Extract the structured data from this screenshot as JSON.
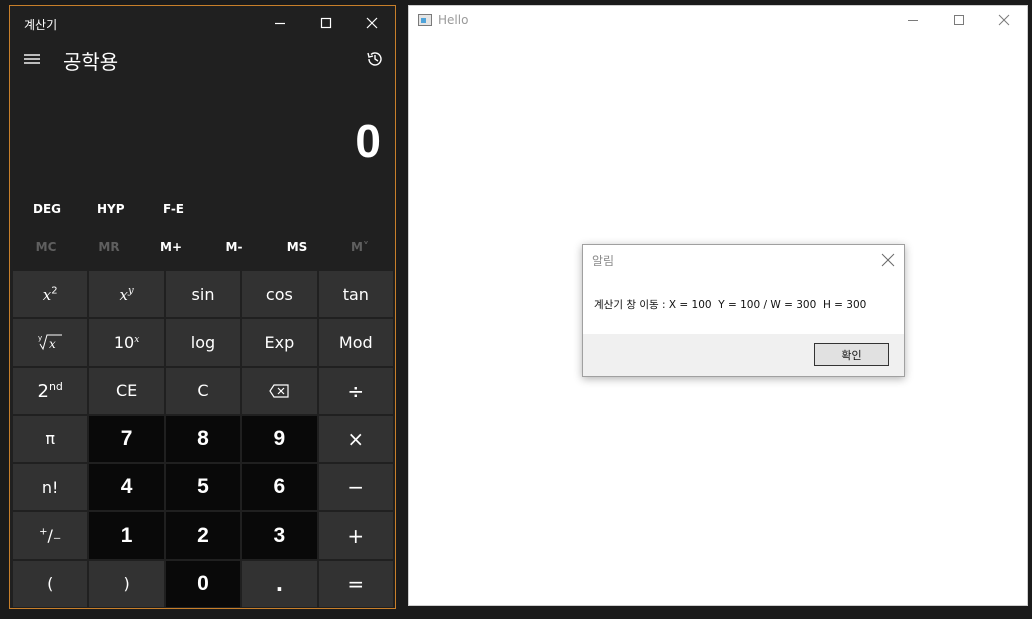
{
  "calculator": {
    "app_title": "계산기",
    "mode_title": "공학용",
    "display_value": "0",
    "mode_buttons": [
      "DEG",
      "HYP",
      "F-E"
    ],
    "memory_buttons": [
      {
        "label": "MC",
        "enabled": false
      },
      {
        "label": "MR",
        "enabled": false
      },
      {
        "label": "M+",
        "enabled": true
      },
      {
        "label": "M-",
        "enabled": true
      },
      {
        "label": "MS",
        "enabled": true
      },
      {
        "label": "M˅",
        "enabled": false
      }
    ],
    "keys": {
      "sin": "sin",
      "cos": "cos",
      "tan": "tan",
      "log": "log",
      "exp": "Exp",
      "mod": "Mod",
      "ce": "CE",
      "c": "C",
      "pi": "π",
      "factorial": "n!",
      "n7": "7",
      "n8": "8",
      "n9": "9",
      "n4": "4",
      "n5": "5",
      "n6": "6",
      "n1": "1",
      "n2": "2",
      "n3": "3",
      "n0": "0",
      "open_paren": "(",
      "close_paren": ")",
      "decimal": ".",
      "divide": "÷",
      "multiply": "×",
      "minus": "−",
      "plus": "+",
      "equals": "="
    },
    "accent": "#c87f2a"
  },
  "hello_window": {
    "title": "Hello"
  },
  "message_box": {
    "title": "알림",
    "text": "계산기 창 이동 : X = 100  Y = 100 / W = 300  H = 300",
    "ok_label": "확인"
  }
}
